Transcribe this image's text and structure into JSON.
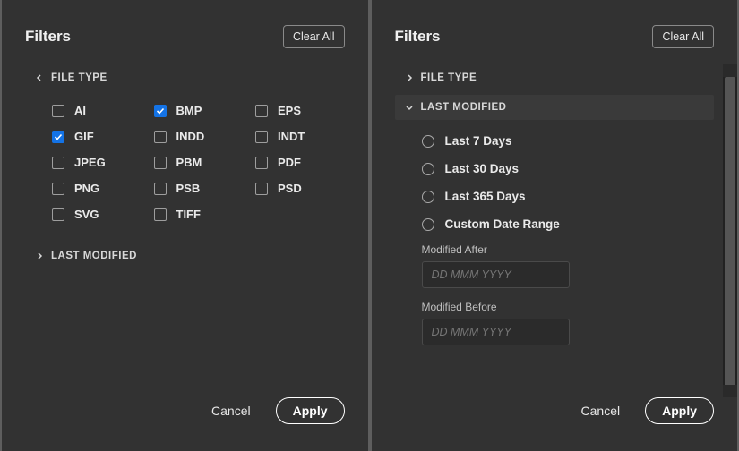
{
  "left": {
    "title": "Filters",
    "clear": "Clear All",
    "fileTypeLabel": "FILE TYPE",
    "lastModifiedLabel": "LAST MODIFIED",
    "types": {
      "ai": "AI",
      "bmp": "BMP",
      "eps": "EPS",
      "gif": "GIF",
      "indd": "INDD",
      "indt": "INDT",
      "jpeg": "JPEG",
      "pbm": "PBM",
      "pdf": "PDF",
      "png": "PNG",
      "psb": "PSB",
      "psd": "PSD",
      "svg": "SVG",
      "tiff": "TIFF"
    },
    "cancel": "Cancel",
    "apply": "Apply"
  },
  "right": {
    "title": "Filters",
    "clear": "Clear All",
    "fileTypeLabel": "FILE TYPE",
    "lastModifiedLabel": "LAST MODIFIED",
    "opts": {
      "d7": "Last 7 Days",
      "d30": "Last 30 Days",
      "d365": "Last 365 Days",
      "custom": "Custom Date Range"
    },
    "afterLabel": "Modified After",
    "beforeLabel": "Modified Before",
    "placeholder": "DD MMM YYYY",
    "cancel": "Cancel",
    "apply": "Apply"
  }
}
